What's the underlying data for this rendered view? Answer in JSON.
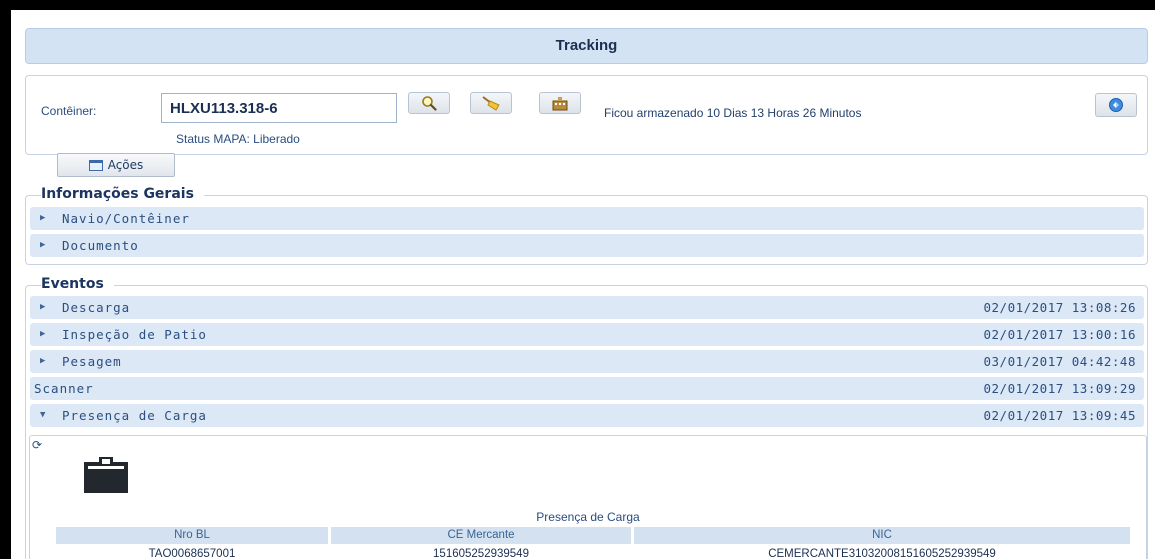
{
  "header": {
    "title": "Tracking"
  },
  "search": {
    "container_label": "Contêiner:",
    "container_value": "HLXU113.318-6",
    "storage_status": "Ficou armazenado 10 Dias 13 Horas 26 Minutos",
    "mapa_status": "Status MAPA: Liberado"
  },
  "actions": {
    "acoes_label": "Ações"
  },
  "general_info": {
    "legend": "Informações Gerais",
    "items": [
      {
        "label": "Navio/Contêiner"
      },
      {
        "label": "Documento"
      }
    ]
  },
  "events": {
    "legend": "Eventos",
    "items": [
      {
        "label": "Descarga",
        "date": "02/01/2017 13:08:26"
      },
      {
        "label": "Inspeção de Patio",
        "date": "02/01/2017 13:00:16"
      },
      {
        "label": "Pesagem",
        "date": "03/01/2017 04:42:48"
      },
      {
        "label": "Scanner",
        "date": "02/01/2017 13:09:29"
      },
      {
        "label": "Presença de Carga",
        "date": "02/01/2017 13:09:45"
      }
    ]
  },
  "presenca": {
    "title": "Presença de Carga",
    "columns": [
      "Nro BL",
      "CE Mercante",
      "NIC"
    ],
    "rows": [
      [
        "TAO0068657001",
        "151605252939549",
        "CEMERCANTE3103200815160525293954​9"
      ]
    ]
  },
  "icons": {
    "search": "magnifier-icon",
    "clear": "broom-icon",
    "history": "building-icon",
    "refresh": "refresh-icon",
    "acoes": "window-icon",
    "expand": "triangle-right-icon",
    "collapse": "triangle-down-icon",
    "loading": "spinner-icon",
    "document": "clipboard-icon"
  },
  "colors": {
    "accent_bg": "#dce8f6",
    "title_bg": "#d4e3f3",
    "text": "#2b4f81"
  }
}
